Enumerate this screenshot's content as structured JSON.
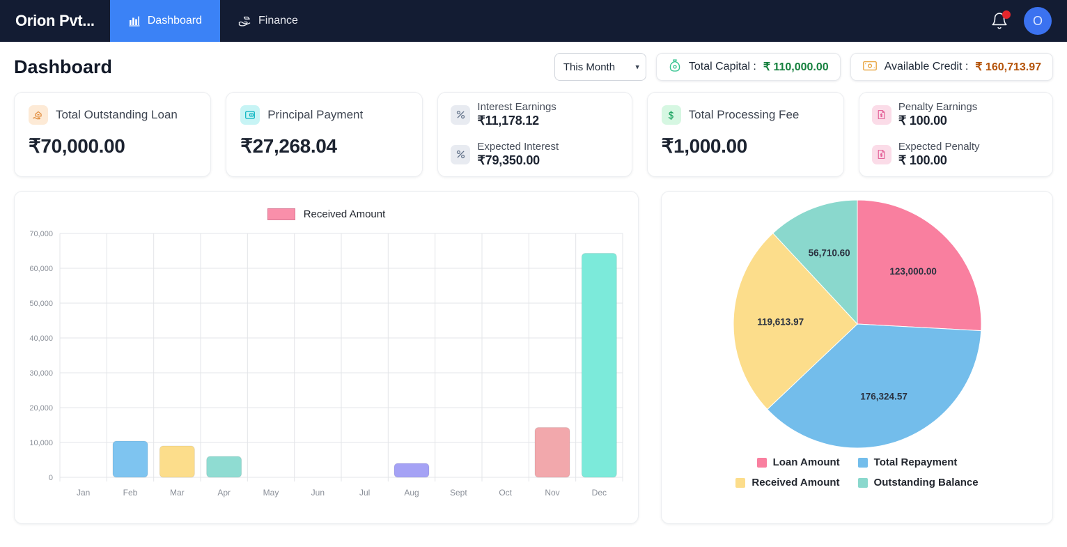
{
  "navbar": {
    "brand": "Orion Pvt...",
    "tabs": [
      {
        "label": "Dashboard",
        "icon": "bar-chart-icon",
        "active": true
      },
      {
        "label": "Finance",
        "icon": "hand-money-icon",
        "active": false
      }
    ],
    "notification_icon": "bell-icon",
    "has_notification": true,
    "avatar_initial": "O"
  },
  "header": {
    "title": "Dashboard",
    "period_selected": "This Month",
    "period_options": [
      "This Month"
    ],
    "total_capital": {
      "label": "Total Capital :",
      "value": "₹ 110,000.00",
      "icon": "money-bag-icon",
      "color": "#15803d"
    },
    "available_credit": {
      "label": "Available Credit :",
      "value": "₹ 160,713.97",
      "icon": "banknote-icon",
      "color": "#b45309"
    }
  },
  "kpis": {
    "outstanding_loan": {
      "label": "Total Outstanding Loan",
      "value": "₹70,000.00",
      "icon": "hand-house-icon"
    },
    "principal_payment": {
      "label": "Principal Payment",
      "value": "₹27,268.04",
      "icon": "wallet-icon"
    },
    "interest": {
      "primary_label": "Interest Earnings",
      "primary_value": "₹11,178.12",
      "secondary_label": "Expected Interest",
      "secondary_value": "₹79,350.00",
      "icon": "percent-icon"
    },
    "processing_fee": {
      "label": "Total Processing Fee",
      "value": "₹1,000.00",
      "icon": "dollar-icon"
    },
    "penalty": {
      "primary_label": "Penalty Earnings",
      "primary_value": "₹ 100.00",
      "secondary_label": "Expected Penalty",
      "secondary_value": "₹ 100.00",
      "icon": "penalty-doc-icon"
    }
  },
  "chart_data": [
    {
      "type": "bar",
      "title": "",
      "legend": [
        "Received Amount"
      ],
      "legend_position": "top-center",
      "categories": [
        "Jan",
        "Feb",
        "Mar",
        "Apr",
        "May",
        "Jun",
        "Jul",
        "Aug",
        "Sept",
        "Oct",
        "Nov",
        "Dec"
      ],
      "values": [
        0,
        10400,
        9000,
        6000,
        0,
        0,
        0,
        4000,
        0,
        0,
        14300,
        64300
      ],
      "bar_colors": [
        "#7ec4f0",
        "#7ec4f0",
        "#fcdd8b",
        "#8fdcd2",
        "#7ec4f0",
        "#7ec4f0",
        "#7ec4f0",
        "#a5a2f5",
        "#7ec4f0",
        "#7ec4f0",
        "#f2a8ac",
        "#7ceada"
      ],
      "xlabel": "",
      "ylabel": "",
      "ylim": [
        0,
        70000
      ],
      "yticks": [
        0,
        10000,
        20000,
        30000,
        40000,
        50000,
        60000,
        70000
      ],
      "ytick_labels": [
        "0",
        "10,000",
        "20,000",
        "30,000",
        "40,000",
        "50,000",
        "60,000",
        "70,000"
      ],
      "grid": true
    },
    {
      "type": "pie",
      "title": "",
      "legend_position": "bottom-center",
      "labels": [
        "Loan Amount",
        "Total Repayment",
        "Received Amount",
        "Outstanding Balance"
      ],
      "values": [
        123000.0,
        176324.57,
        119613.97,
        56710.6
      ],
      "value_labels": [
        "123,000.00",
        "176,324.57",
        "119,613.97",
        "56,710.60"
      ],
      "colors": [
        "#f97f9f",
        "#73bdeb",
        "#fcdd8b",
        "#8ad8cd"
      ]
    }
  ]
}
